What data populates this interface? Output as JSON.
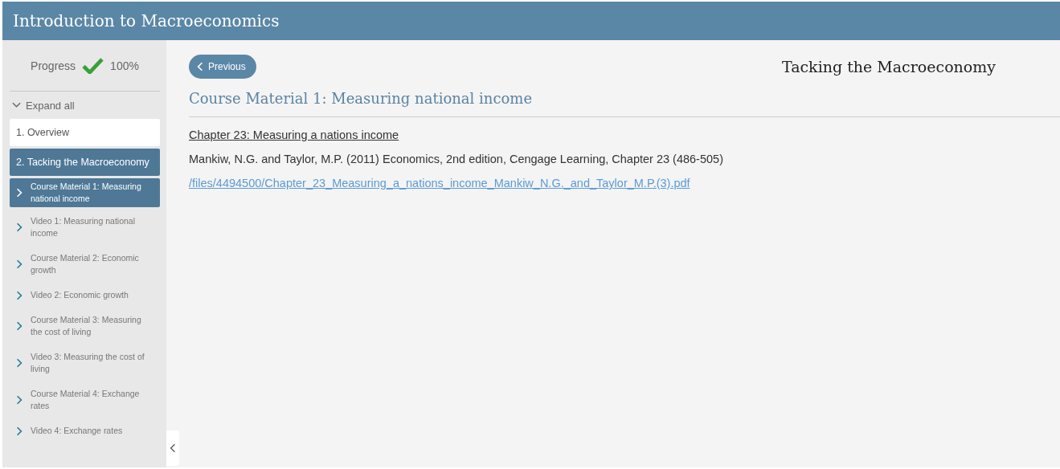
{
  "header": {
    "title": "Introduction to Macroeconomics"
  },
  "sidebar": {
    "progress_label": "Progress",
    "progress_complete": true,
    "progress_value": "100%",
    "expand_all": "Expand all",
    "modules": [
      {
        "label": "1. Overview",
        "selected": false
      },
      {
        "label": "2. Tacking the Macroeconomy",
        "selected": true,
        "children": [
          {
            "label": "Course Material 1: Measuring national income",
            "selected": true
          },
          {
            "label": "Video 1: Measuring national income",
            "selected": false
          },
          {
            "label": "Course Material 2: Economic growth",
            "selected": false
          },
          {
            "label": "Video 2: Economic growth",
            "selected": false
          },
          {
            "label": "Course Material 3: Measuring the cost of living",
            "selected": false
          },
          {
            "label": "Video 3: Measuring the cost of living",
            "selected": false
          },
          {
            "label": "Course Material 4: Exchange rates",
            "selected": false
          },
          {
            "label": "Video 4: Exchange rates",
            "selected": false
          }
        ]
      }
    ]
  },
  "content": {
    "previous_button": "Previous",
    "module_title": "Tacking the Macroeconomy",
    "heading": "Course Material 1: Measuring national income",
    "chapter_link": "Chapter 23: Measuring a nations income",
    "reference": "Mankiw, N.G. and Taylor, M.P. (2011) Economics, 2nd edition, Cengage Learning, Chapter 23 (486-505)",
    "file_link": "/files/4494500/Chapter_23_Measuring_a_nations_income_Mankiw_N.G._and_Taylor_M.P.(3).pdf"
  }
}
